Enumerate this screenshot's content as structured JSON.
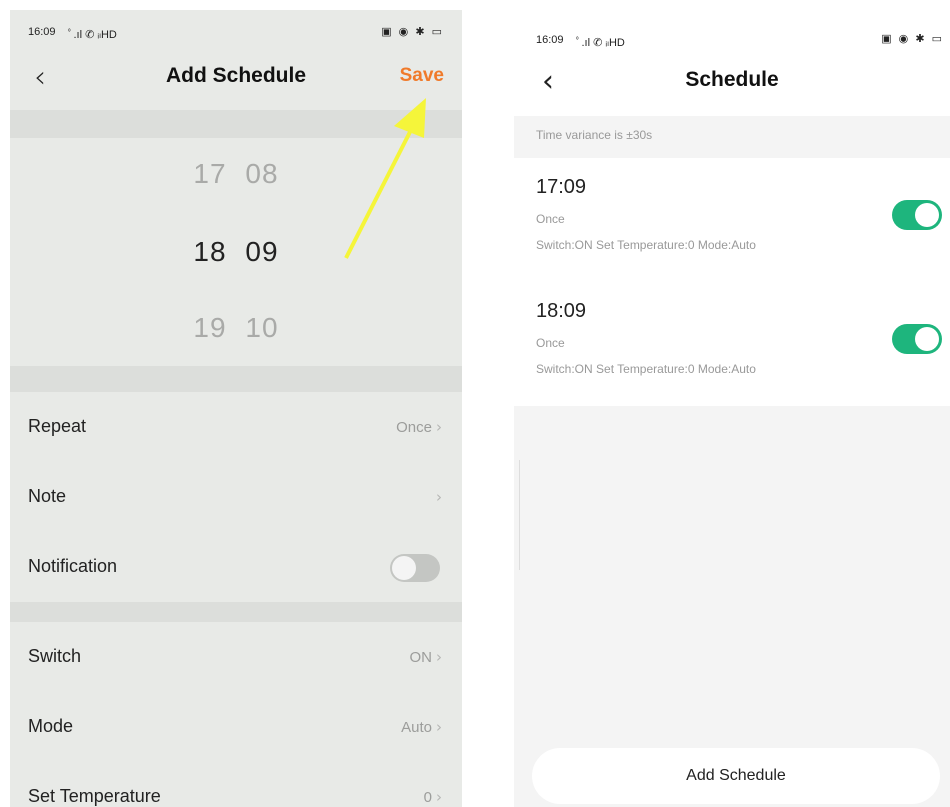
{
  "left": {
    "status": {
      "time": "16:09",
      "signal": "ﾟ.ıl ✆ ᵢₗHD",
      "right_icons": "▣ ◉ ✱ ▭"
    },
    "nav": {
      "back": "‹",
      "title": "Add Schedule",
      "save": "Save"
    },
    "picker": {
      "prev": {
        "hour": "17",
        "minute": "08"
      },
      "selected": {
        "hour": "18",
        "minute": "09"
      },
      "next": {
        "hour": "19",
        "minute": "10"
      }
    },
    "rows": {
      "repeat": {
        "label": "Repeat",
        "value": "Once"
      },
      "note": {
        "label": "Note",
        "value": ""
      },
      "notification": {
        "label": "Notification",
        "enabled": false
      },
      "switch": {
        "label": "Switch",
        "value": "ON"
      },
      "mode": {
        "label": "Mode",
        "value": "Auto"
      },
      "temperature": {
        "label": "Set Temperature",
        "value": "0"
      }
    },
    "chevron": "›"
  },
  "right": {
    "status": {
      "time": "16:09",
      "signal": "ﾟ.ıl ✆ ᵢₗHD",
      "right_icons": "▣ ◉ ✱ ▭"
    },
    "nav": {
      "back": "‹",
      "title": "Schedule"
    },
    "variance": "Time variance is ±30s",
    "schedules": [
      {
        "time": "17:09",
        "repeat": "Once",
        "details": "Switch:ON  Set Temperature:0  Mode:Auto",
        "enabled": true
      },
      {
        "time": "18:09",
        "repeat": "Once",
        "details": "Switch:ON  Set Temperature:0  Mode:Auto",
        "enabled": true
      }
    ],
    "add_button": "Add Schedule"
  },
  "colors": {
    "accent_save": "#f07a2a",
    "toggle_on": "#1eb57d",
    "arrow": "#f5f53a"
  }
}
